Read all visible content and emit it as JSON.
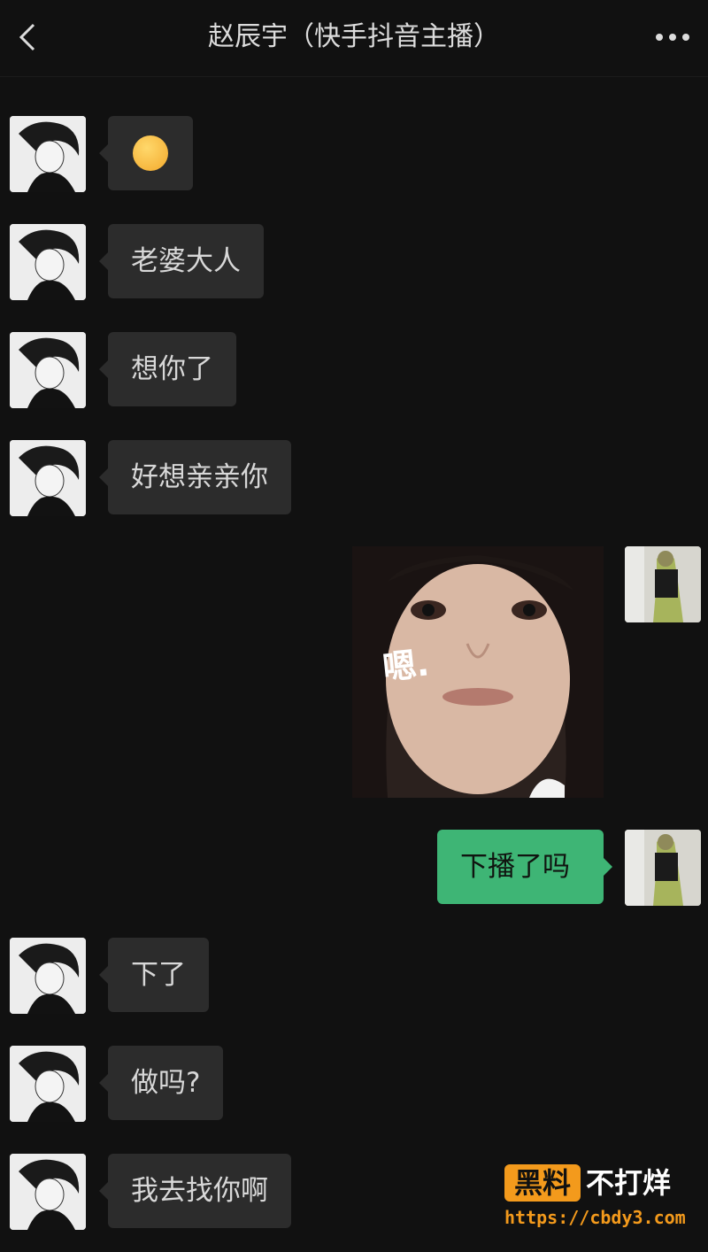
{
  "header": {
    "title": "赵辰宇（快手抖音主播）",
    "back_icon": "chevron-left-icon",
    "more_icon": "more-dots-icon"
  },
  "messages": [
    {
      "side": "in",
      "type": "emoji",
      "emoji": "kissing-face-emoji"
    },
    {
      "side": "in",
      "type": "text",
      "text": "老婆大人"
    },
    {
      "side": "in",
      "type": "text",
      "text": "想你了"
    },
    {
      "side": "in",
      "type": "text",
      "text": "好想亲亲你"
    },
    {
      "side": "out",
      "type": "image",
      "overlay_text": "嗯."
    },
    {
      "side": "out",
      "type": "text",
      "text": "下播了吗"
    },
    {
      "side": "in",
      "type": "text",
      "text": "下了"
    },
    {
      "side": "in",
      "type": "text",
      "text": "做吗?"
    },
    {
      "side": "in",
      "type": "text",
      "text": "我去找你啊"
    }
  ],
  "watermark": {
    "badge": "黑料",
    "title": "不打烊",
    "url": "https://cbdy3.com"
  },
  "colors": {
    "background": "#111111",
    "incoming_bubble": "#2c2c2c",
    "outgoing_bubble": "#3eb575",
    "watermark_accent": "#f39a1c"
  }
}
